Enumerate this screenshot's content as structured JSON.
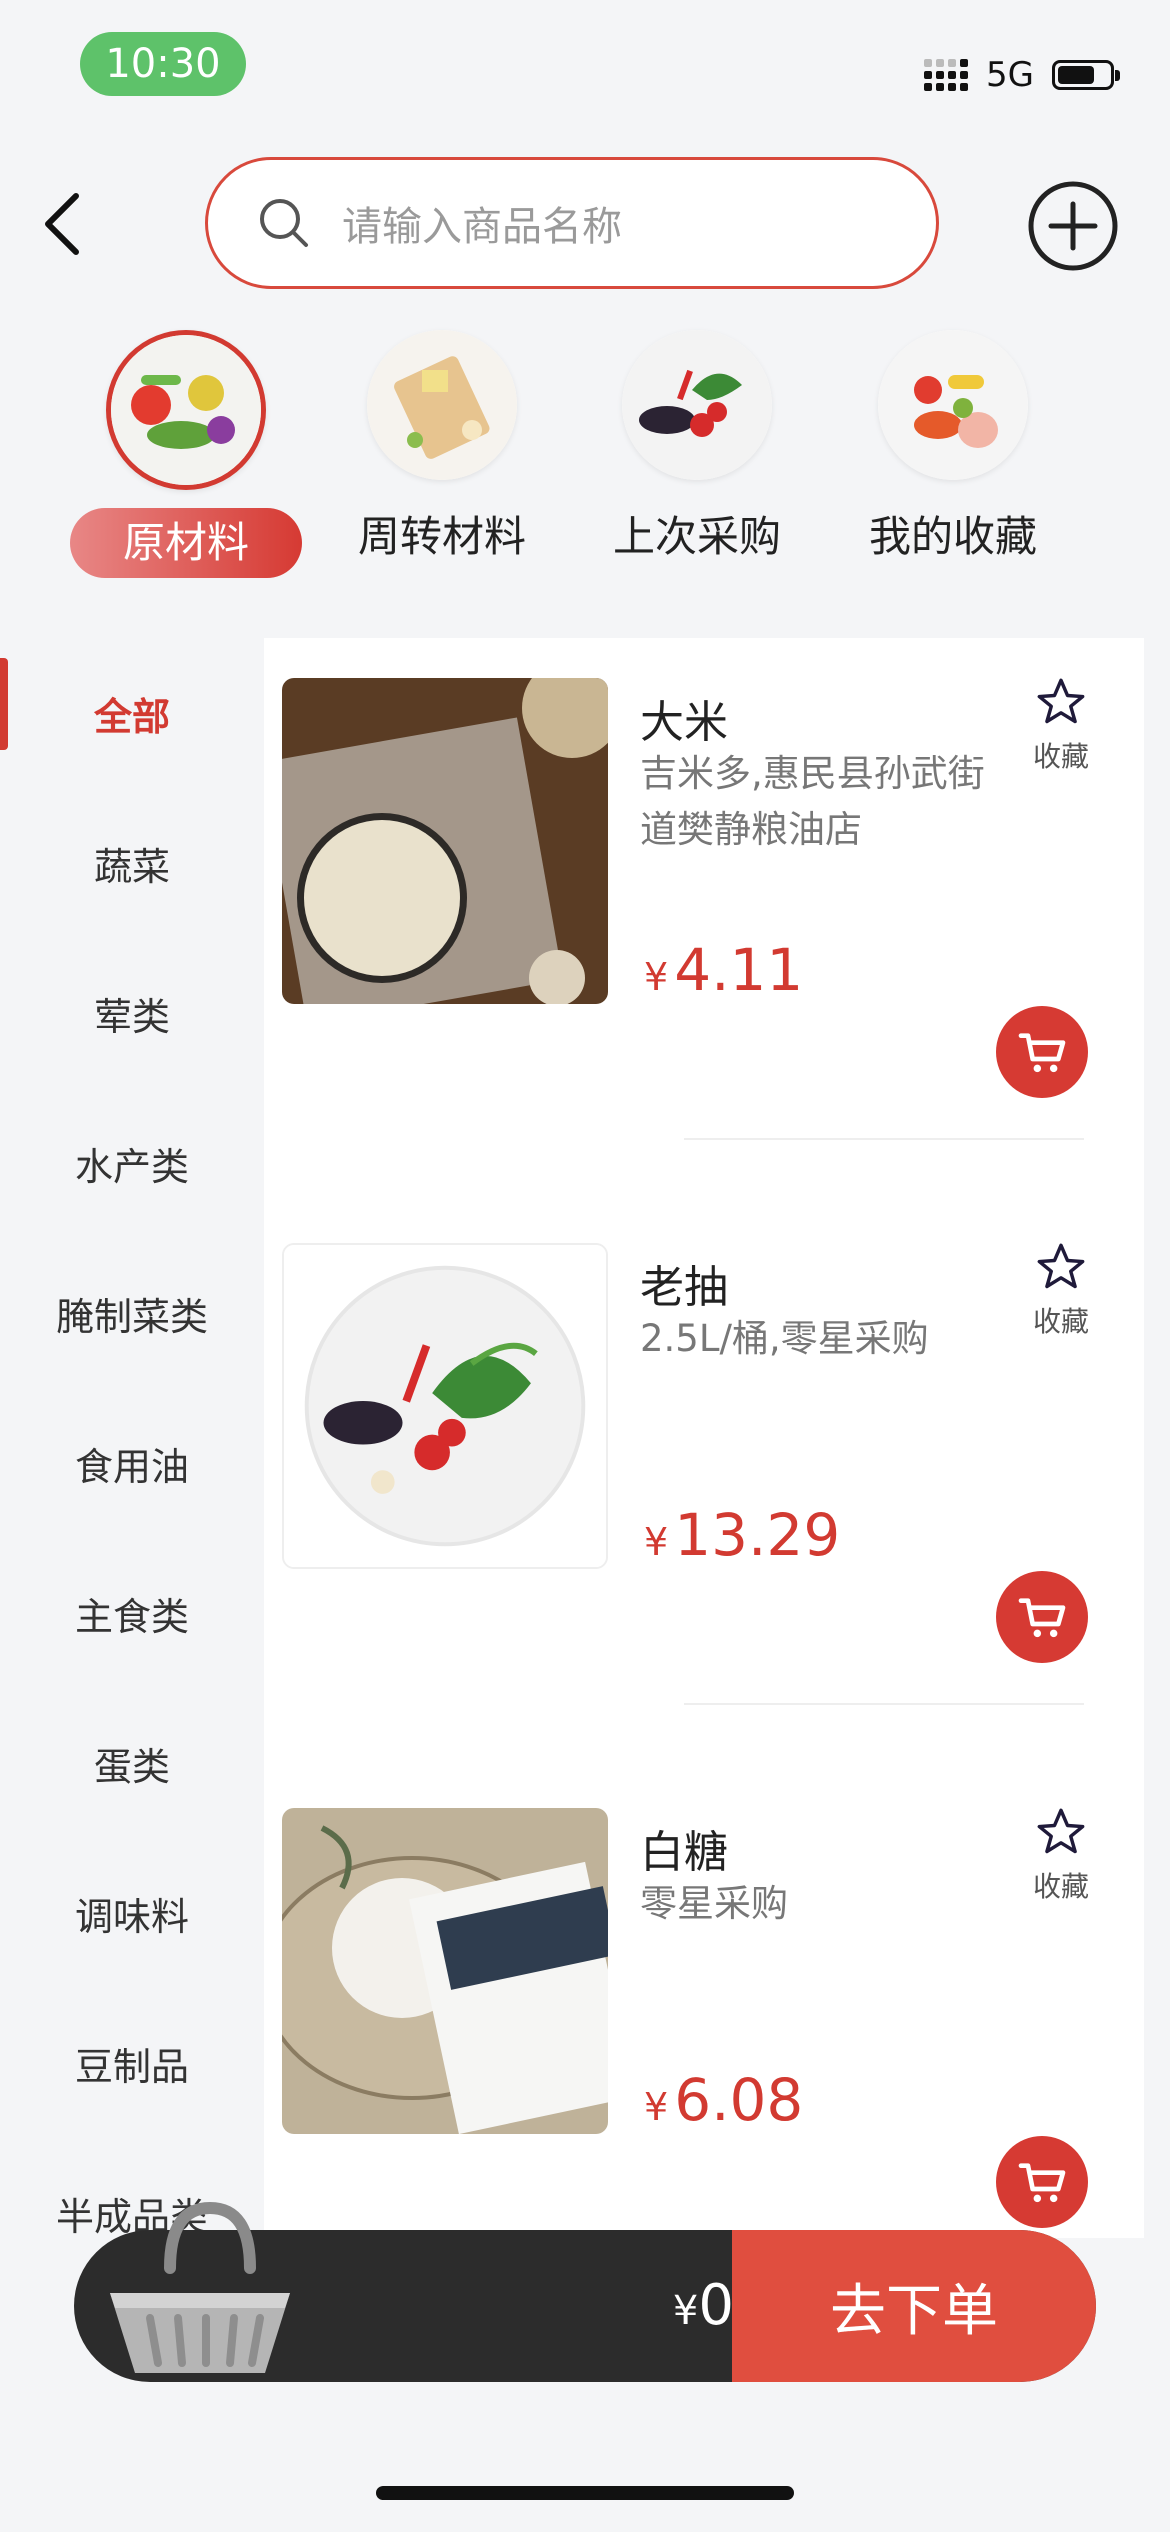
{
  "status_bar": {
    "time": "10:30",
    "network": "5G"
  },
  "header": {
    "search_placeholder": "请输入商品名称"
  },
  "categories": [
    {
      "label": "原材料",
      "active": true
    },
    {
      "label": "周转材料",
      "active": false
    },
    {
      "label": "上次采购",
      "active": false
    },
    {
      "label": "我的收藏",
      "active": false
    }
  ],
  "sidebar": {
    "items": [
      "全部",
      "蔬菜",
      "荤类",
      "水产类",
      "腌制菜类",
      "食用油",
      "主食类",
      "蛋类",
      "调味料",
      "豆制品",
      "半成品类"
    ],
    "active_index": 0
  },
  "products": [
    {
      "name": "大米",
      "desc": "吉米多,惠民县孙武街道樊静粮油店",
      "currency": "¥",
      "price": "4.11",
      "fav_label": "收藏"
    },
    {
      "name": "老抽",
      "desc": "2.5L/桶,零星采购",
      "currency": "¥",
      "price": "13.29",
      "fav_label": "收藏"
    },
    {
      "name": "白糖",
      "desc": "零星采购",
      "currency": "¥",
      "price": "6.08",
      "fav_label": "收藏"
    }
  ],
  "cart": {
    "currency": "¥",
    "total": "0",
    "order_label": "去下单"
  },
  "colors": {
    "accent": "#d23a31",
    "order": "#e04e3f",
    "bar": "#2c2c2c",
    "status_pill": "#5ec26a"
  }
}
